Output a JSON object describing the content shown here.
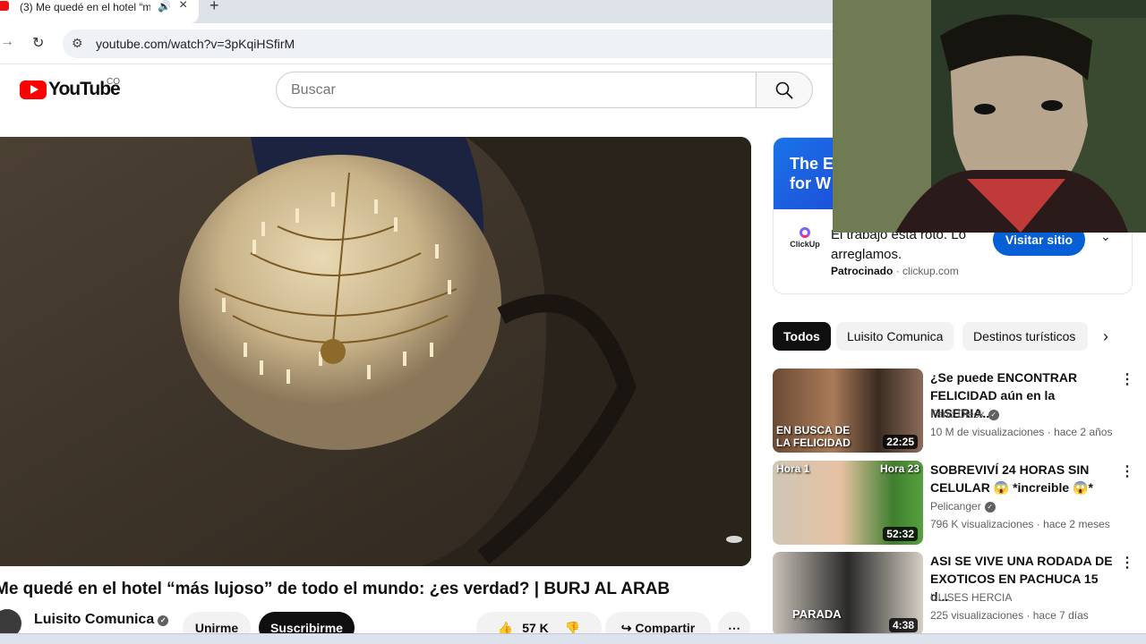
{
  "browser": {
    "tab_title": "(3) Me quedé en el hotel “m",
    "audio_icon": "speaker-icon",
    "url": "youtube.com/watch?v=3pKqiHSfirM"
  },
  "header": {
    "logo_text": "YouTube",
    "country_code": "CO",
    "search_placeholder": "Buscar"
  },
  "video": {
    "title": "Me quedé en el hotel “más lujoso” de todo el mundo: ¿es verdad? | BURJ AL ARAB",
    "channel": "Luisito Comunica",
    "join_label": "Unirme",
    "subscribe_label": "Suscribirme",
    "likes": "57 K",
    "share_label": "Compartir"
  },
  "ad": {
    "banner_text": "The E for W",
    "advertiser": "ClickUp",
    "headline": "El trabajo está roto. Lo arreglamos.",
    "sponsored_label": "Patrocinado",
    "domain": "clickup.com",
    "cta": "Visitar sitio"
  },
  "chips": [
    "Todos",
    "Luisito Comunica",
    "Destinos turísticos"
  ],
  "recommendations": [
    {
      "title": "¿Se puede ENCONTRAR FELICIDAD aún en la MISERIA...",
      "channel": "Farid Dieck",
      "views": "10 M de visualizaciones",
      "age": "hace 2 años",
      "duration": "22:25",
      "thumb_text": "EN BUSCA DE LA FELICIDAD"
    },
    {
      "title": "SOBREVIVÍ 24 HORAS SIN CELULAR 😱 *increible 😱*",
      "channel": "Pelicanger",
      "views": "796 K visualizaciones",
      "age": "hace 2 meses",
      "duration": "52:32",
      "thumb_text_left": "Hora 1",
      "thumb_text_right": "Hora 23"
    },
    {
      "title": "ASI SE VIVE UNA RODADA DE EXOTICOS EN PACHUCA 15 d...",
      "channel": "ULISES HERCIA",
      "views": "225 visualizaciones",
      "age": "hace 7 días",
      "duration": "4:38",
      "thumb_text": "PARADA"
    }
  ],
  "colors": {
    "brand_red": "#ff0000",
    "cta_blue": "#065fd4",
    "chip_active": "#0f0f0f"
  }
}
